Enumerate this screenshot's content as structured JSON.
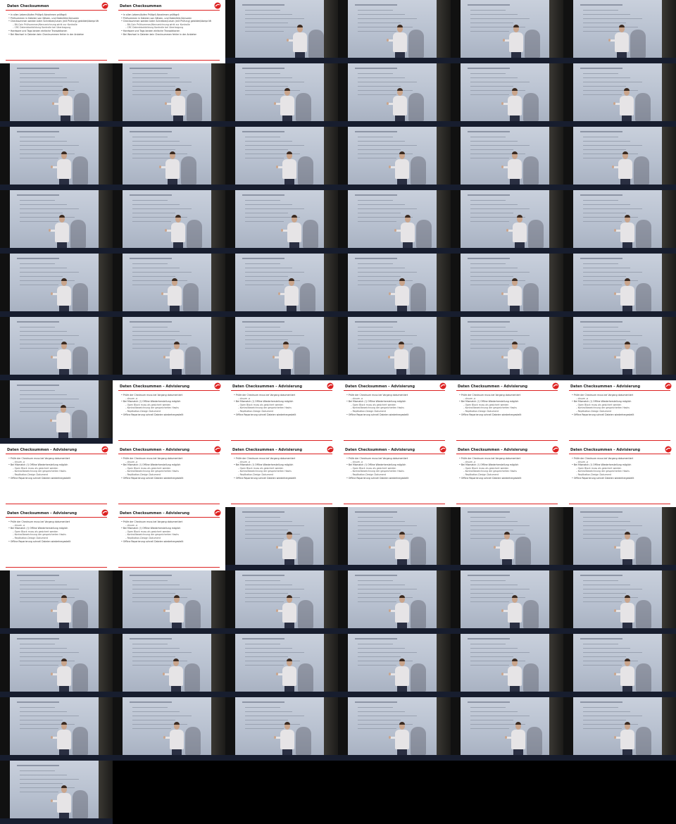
{
  "slides": [
    {
      "title": "Daten Checksummen",
      "lines": [
        {
          "text": "In allen Lebensläufen Prüfgrö Abnahmen prüfbgrö",
          "sub": false
        },
        {
          "text": "Prüfsummen in Dateien von Sätzen- und Datenfeld-Sensoren",
          "sub": false
        },
        {
          "text": "Checksummen werden beim Schreiben/Lesen (mit Prüfung) gebildet/überprüft",
          "sub": false
        },
        {
          "text": "Bit-Coin Prüfsummen/Kennzeichnung wirkt zur Kontrolle",
          "sub": true
        },
        {
          "text": "CRC Datenblockbildung Kontrolle bei Übertragung",
          "sub": true
        },
        {
          "text": "Hardware und Tags binden einfache Transaktionen",
          "sub": false
        },
        {
          "text": "Bei Wechsel in Dateien kein Checksummen fehler in der Anbieter",
          "sub": false
        }
      ]
    },
    {
      "title": "Daten Checksummen – Advisierung",
      "lines": [
        {
          "text": "Prüfe der Checksum muss bei Vorgang dokumentiert",
          "sub": false
        },
        {
          "text": "cksum -a",
          "sub": true
        },
        {
          "text": "Bei Mismatch (!) Offline Wiederherstellung möglich",
          "sub": false
        },
        {
          "text": "Open Block muss als gesichert werden",
          "sub": true
        },
        {
          "text": "Kontrollbezeichnung der gespeicherten Hashs",
          "sub": true
        },
        {
          "text": "Replikation-Design Dokument",
          "sub": true
        },
        {
          "text": "Offline Reparierung schnell Dateien wiederhergestellt",
          "sub": false
        }
      ]
    }
  ],
  "tiles": [
    {
      "kind": "slide",
      "slide": 0
    },
    {
      "kind": "slide",
      "slide": 0
    },
    {
      "kind": "cam",
      "pos": 0.66,
      "shadow": 0.9
    },
    {
      "kind": "cam",
      "pos": 0.55,
      "shadow": 0.85
    },
    {
      "kind": "cam",
      "pos": 0.58,
      "shadow": 0.9
    },
    {
      "kind": "cam",
      "pos": 0.52,
      "shadow": 0.9
    },
    {
      "kind": "cam",
      "pos": 0.58,
      "shadow": 0.85
    },
    {
      "kind": "cam",
      "pos": 0.58,
      "shadow": 0.85
    },
    {
      "kind": "cam",
      "pos": 0.55,
      "shadow": 0.85
    },
    {
      "kind": "cam",
      "pos": 0.55,
      "shadow": 0.85
    },
    {
      "kind": "cam",
      "pos": 0.57,
      "shadow": 0.85
    },
    {
      "kind": "cam",
      "pos": 0.56,
      "shadow": 0.85
    },
    {
      "kind": "cam",
      "pos": 0.57,
      "shadow": 0.85
    },
    {
      "kind": "cam",
      "pos": 0.53,
      "shadow": 0.85
    },
    {
      "kind": "cam",
      "pos": 0.57,
      "shadow": 0.85
    },
    {
      "kind": "cam",
      "pos": 0.57,
      "shadow": 0.85
    },
    {
      "kind": "cam",
      "pos": 0.57,
      "shadow": 0.85
    },
    {
      "kind": "cam",
      "pos": 0.55,
      "shadow": 0.9
    },
    {
      "kind": "cam",
      "pos": 0.55,
      "shadow": 0.85
    },
    {
      "kind": "cam",
      "pos": 0.58,
      "shadow": 0.85
    },
    {
      "kind": "cam",
      "pos": 0.61,
      "shadow": 0.85
    },
    {
      "kind": "cam",
      "pos": 0.62,
      "shadow": 0.85
    },
    {
      "kind": "cam",
      "pos": 0.61,
      "shadow": 0.9
    },
    {
      "kind": "cam",
      "pos": 0.57,
      "shadow": 0.85
    },
    {
      "kind": "cam",
      "pos": 0.57,
      "shadow": 0.85
    },
    {
      "kind": "cam",
      "pos": 0.55,
      "shadow": 0.85
    },
    {
      "kind": "cam",
      "pos": 0.59,
      "shadow": 0.85
    },
    {
      "kind": "cam",
      "pos": 0.57,
      "shadow": 0.85
    },
    {
      "kind": "cam",
      "pos": 0.57,
      "shadow": 0.85
    },
    {
      "kind": "cam",
      "pos": 0.57,
      "shadow": 0.85
    },
    {
      "kind": "cam",
      "pos": 0.57,
      "shadow": 0.85
    },
    {
      "kind": "cam",
      "pos": 0.57,
      "shadow": 0.85
    },
    {
      "kind": "cam",
      "pos": 0.54,
      "shadow": 0.85
    },
    {
      "kind": "cam",
      "pos": 0.56,
      "shadow": 0.85
    },
    {
      "kind": "cam",
      "pos": 0.57,
      "shadow": 0.85
    },
    {
      "kind": "cam",
      "pos": 0.57,
      "shadow": 0.85
    },
    {
      "kind": "cam",
      "pos": 0.56,
      "shadow": 0.85
    },
    {
      "kind": "slide",
      "slide": 1
    },
    {
      "kind": "slide",
      "slide": 1
    },
    {
      "kind": "slide",
      "slide": 1
    },
    {
      "kind": "slide",
      "slide": 1
    },
    {
      "kind": "slide",
      "slide": 1
    },
    {
      "kind": "slide",
      "slide": 1
    },
    {
      "kind": "slide",
      "slide": 1
    },
    {
      "kind": "slide",
      "slide": 1
    },
    {
      "kind": "slide",
      "slide": 1
    },
    {
      "kind": "slide",
      "slide": 1
    },
    {
      "kind": "slide",
      "slide": 1
    },
    {
      "kind": "slide",
      "slide": 1
    },
    {
      "kind": "slide",
      "slide": 1
    },
    {
      "kind": "cam",
      "pos": 0.57,
      "shadow": 0.85
    },
    {
      "kind": "cam",
      "pos": 0.57,
      "shadow": 0.85
    },
    {
      "kind": "cam",
      "pos": 0.5,
      "shadow": 0.85
    },
    {
      "kind": "cam",
      "pos": 0.57,
      "shadow": 0.85
    },
    {
      "kind": "cam",
      "pos": 0.57,
      "shadow": 0.85
    },
    {
      "kind": "cam",
      "pos": 0.57,
      "shadow": 0.85
    },
    {
      "kind": "cam",
      "pos": 0.57,
      "shadow": 0.85
    },
    {
      "kind": "cam",
      "pos": 0.57,
      "shadow": 0.85
    },
    {
      "kind": "cam",
      "pos": 0.57,
      "shadow": 0.85
    },
    {
      "kind": "cam",
      "pos": 0.57,
      "shadow": 0.85
    },
    {
      "kind": "cam",
      "pos": 0.57,
      "shadow": 0.85
    },
    {
      "kind": "cam",
      "pos": 0.56,
      "shadow": 0.85
    },
    {
      "kind": "cam",
      "pos": 0.57,
      "shadow": 0.85
    },
    {
      "kind": "cam",
      "pos": 0.57,
      "shadow": 0.85
    },
    {
      "kind": "cam",
      "pos": 0.57,
      "shadow": 0.85
    },
    {
      "kind": "cam",
      "pos": 0.57,
      "shadow": 0.85
    },
    {
      "kind": "cam",
      "pos": 0.57,
      "shadow": 0.85
    },
    {
      "kind": "cam",
      "pos": 0.57,
      "shadow": 0.85
    },
    {
      "kind": "cam",
      "pos": 0.55,
      "shadow": 0.85
    },
    {
      "kind": "cam",
      "pos": 0.57,
      "shadow": 0.85
    },
    {
      "kind": "cam",
      "pos": 0.6,
      "shadow": 0.85
    },
    {
      "kind": "cam",
      "pos": 0.57,
      "shadow": 0.85
    },
    {
      "kind": "cam",
      "pos": 0.57,
      "shadow": 0.85
    }
  ],
  "colors": {
    "accent": "#dd2222",
    "screen": "#c4cbd8",
    "shirt": "#e6e4e6",
    "floor": "#171d2e"
  }
}
